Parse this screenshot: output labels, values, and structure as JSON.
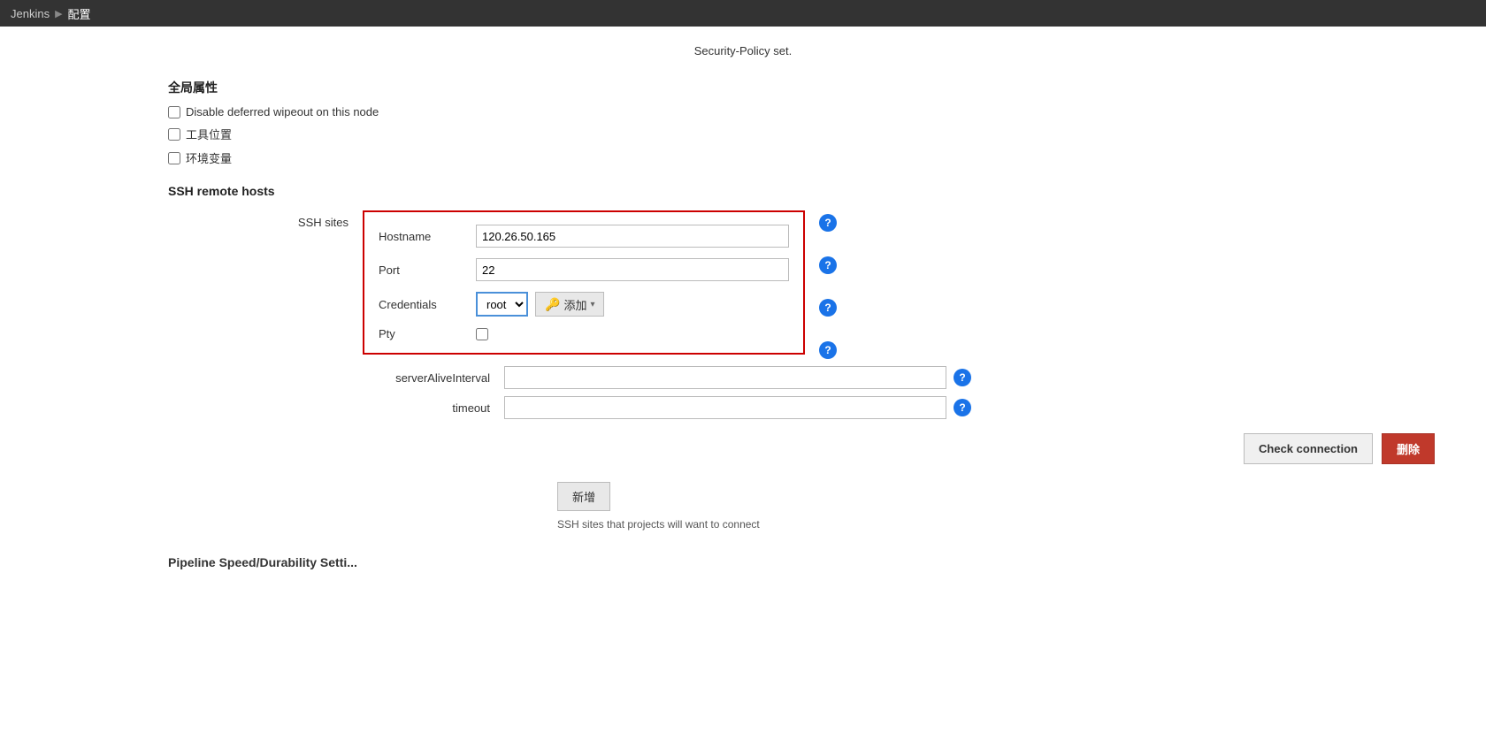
{
  "topbar": {
    "home_label": "Jenkins",
    "separator": "▶",
    "current_label": "配置"
  },
  "security_policy": {
    "text": "Security-Policy set."
  },
  "global_props": {
    "section_header": "全局属性",
    "checkbox_wipeout": "Disable deferred wipeout on this node",
    "checkbox_tools": "工具位置",
    "checkbox_env": "环境变量"
  },
  "ssh_section": {
    "section_header": "SSH remote hosts",
    "ssh_sites_label": "SSH sites",
    "hostname_label": "Hostname",
    "hostname_value": "120.26.50.165",
    "port_label": "Port",
    "port_value": "22",
    "credentials_label": "Credentials",
    "credentials_value": "root",
    "credentials_options": [
      "root"
    ],
    "pty_label": "Pty",
    "server_alive_label": "serverAliveInterval",
    "server_alive_value": "",
    "timeout_label": "timeout",
    "timeout_value": "",
    "check_connection_label": "Check connection",
    "delete_label": "删除",
    "add_new_label": "新增",
    "add_credentials_label": "添加",
    "ssh_hint": "SSH sites that projects will want to connect"
  },
  "pipeline_section": {
    "header": "Pipeline Speed/Durability Setti..."
  },
  "icons": {
    "help": "?",
    "key": "🔑",
    "arrow_down": "▾"
  }
}
